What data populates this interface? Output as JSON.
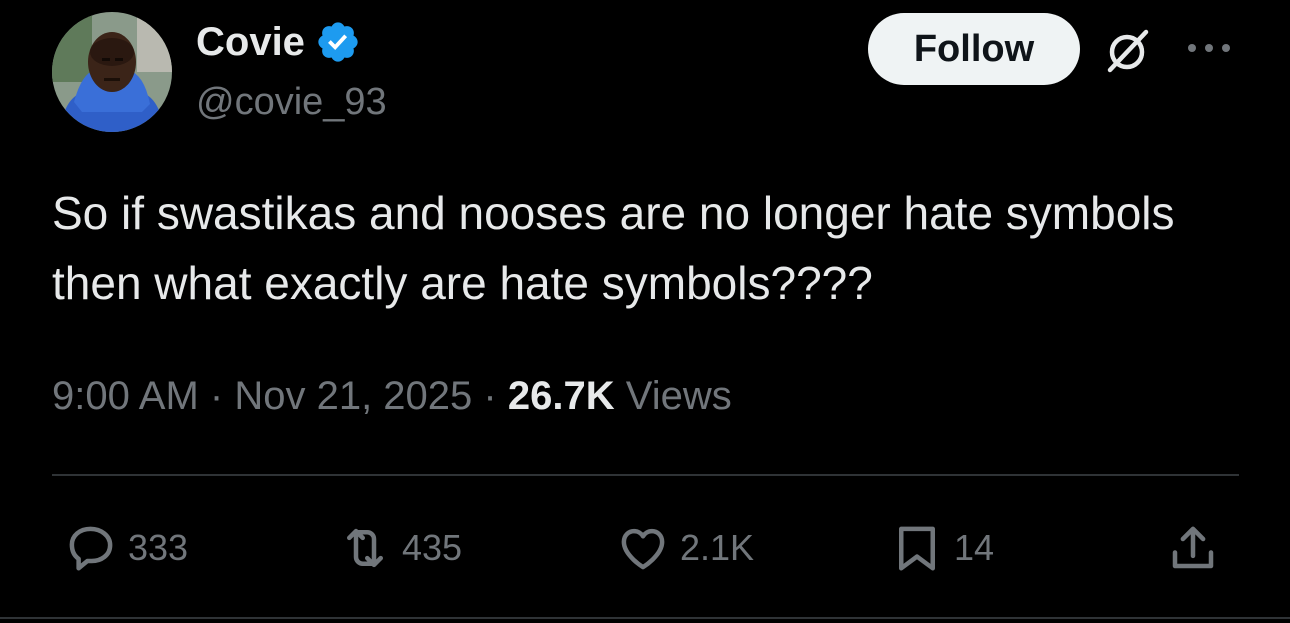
{
  "author": {
    "display_name": "Covie",
    "handle": "@covie_93",
    "verified_icon": "verified-badge-icon",
    "badge_color": "#1d9bf0"
  },
  "header": {
    "follow_label": "Follow",
    "grok_icon": "grok-icon",
    "more_icon": "more-icon"
  },
  "tweet": {
    "text": "So if swastikas and nooses are no longer hate symbols then what exactly are hate symbols????"
  },
  "meta": {
    "time": "9:00 AM",
    "separator": "·",
    "date": "Nov 21, 2025",
    "views_count": "26.7K",
    "views_label": "Views"
  },
  "actions": {
    "reply": {
      "icon": "reply-icon",
      "count": "333"
    },
    "repost": {
      "icon": "repost-icon",
      "count": "435"
    },
    "like": {
      "icon": "heart-icon",
      "count": "2.1K"
    },
    "bookmark": {
      "icon": "bookmark-icon",
      "count": "14"
    },
    "share": {
      "icon": "share-icon"
    }
  },
  "colors": {
    "background": "#000000",
    "primary_text": "#e7e9ea",
    "secondary_text": "#71767b",
    "divider": "#2f3336"
  }
}
